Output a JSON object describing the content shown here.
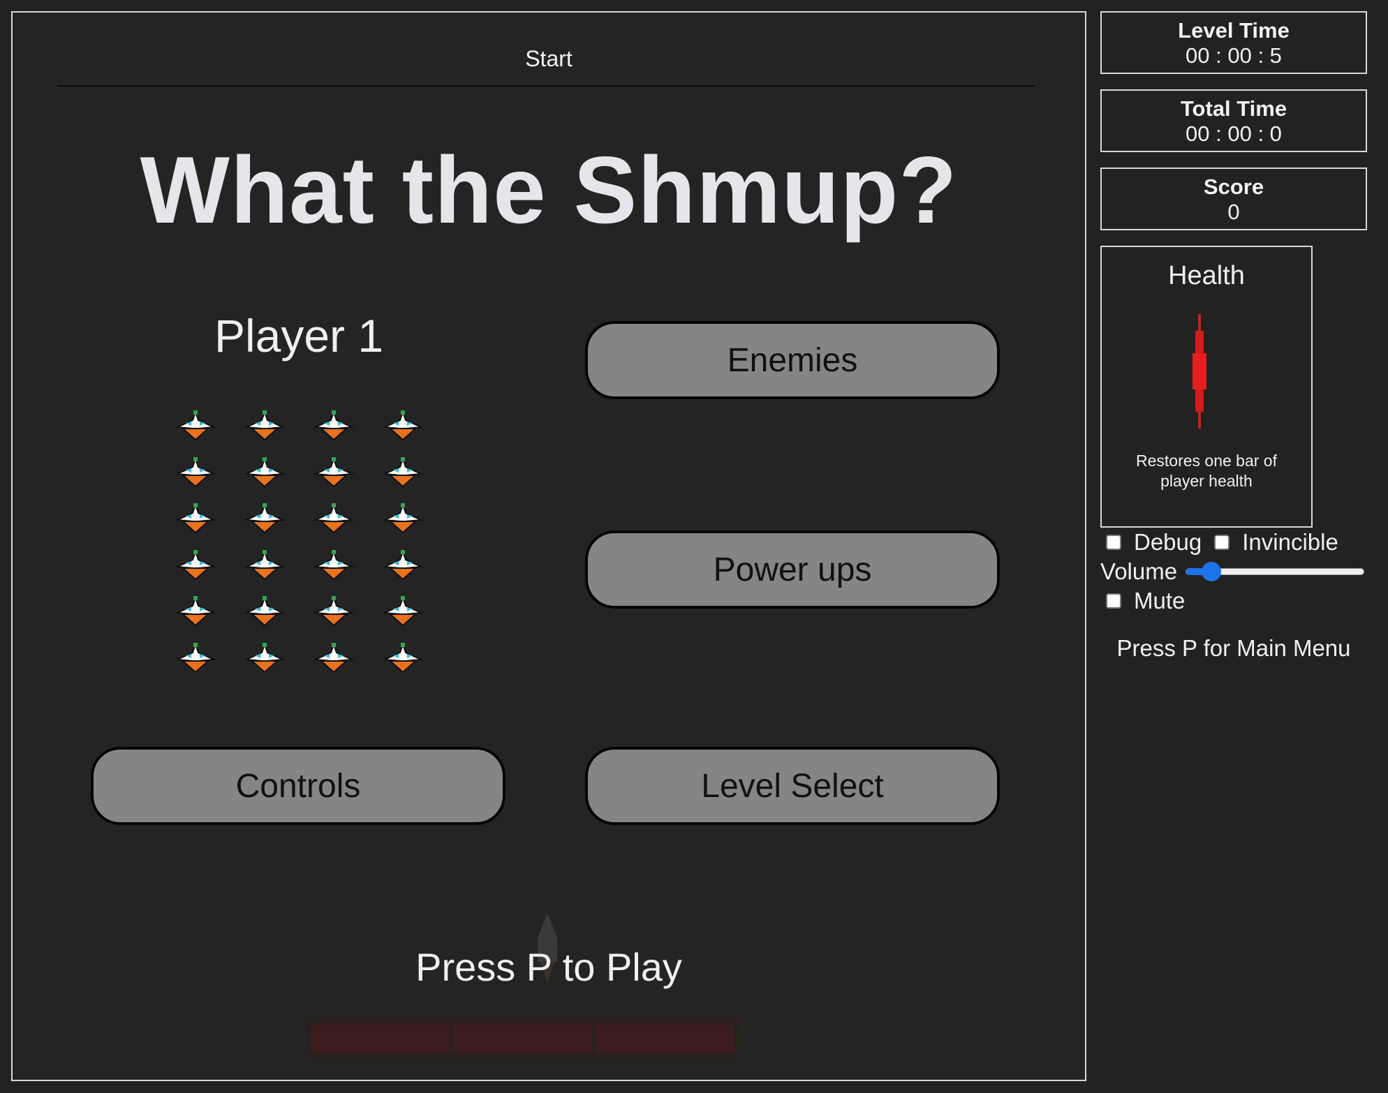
{
  "game": {
    "level_label": "Start",
    "title": "What the Shmup?",
    "player_label": "Player 1",
    "ship_grid": {
      "columns": 4,
      "rows": 6
    },
    "buttons": {
      "enemies": "Enemies",
      "power_ups": "Power ups",
      "controls": "Controls",
      "level_select": "Level Select"
    },
    "press_play": "Press P to Play"
  },
  "sidebar": {
    "level_time": {
      "label": "Level Time",
      "value": "00 : 00 : 5"
    },
    "total_time": {
      "label": "Total Time",
      "value": "00 : 00 : 0"
    },
    "score": {
      "label": "Score",
      "value": "0"
    },
    "powerup_card": {
      "title": "Health",
      "icon": "health-bar-icon",
      "description": "Restores one bar of player health"
    },
    "options": {
      "debug_label": "Debug",
      "debug_checked": false,
      "invincible_label": "Invincible",
      "invincible_checked": false,
      "volume_label": "Volume",
      "volume_level": 0.1,
      "mute_label": "Mute",
      "mute_checked": false
    },
    "main_menu_hint": "Press P for Main Menu"
  },
  "colors": {
    "background": "#222222",
    "button_fill": "#858585",
    "health_red": "#e02020",
    "slider_accent": "#1a73e8"
  }
}
